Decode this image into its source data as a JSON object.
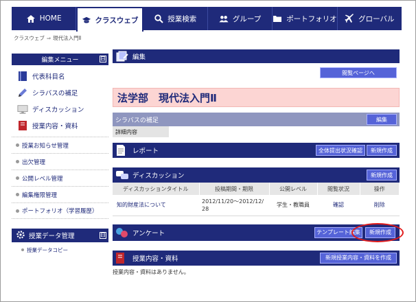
{
  "nav": {
    "tabs": [
      {
        "label": "HOME",
        "icon": "home-icon",
        "active": false
      },
      {
        "label": "クラスウェブ",
        "icon": "graduation-cap-icon",
        "active": true
      },
      {
        "label": "授業検索",
        "icon": "search-icon",
        "active": false
      },
      {
        "label": "グループ",
        "icon": "users-icon",
        "active": false
      },
      {
        "label": "ポートフォリオ",
        "icon": "folder-icon",
        "active": false
      },
      {
        "label": "グローバル",
        "icon": "plane-icon",
        "active": false
      }
    ]
  },
  "breadcrumb": {
    "root": "クラスウェブ",
    "sep": "⇒",
    "current": "現代法入門Ⅱ"
  },
  "sidebar": {
    "edit_menu_title": "編集メニュー",
    "minimize": "⊟",
    "icon_items": [
      {
        "label": "代表科目名",
        "icon": "book-icon"
      },
      {
        "label": "シラバスの補足",
        "icon": "pen-icon"
      },
      {
        "label": "ディスカッション",
        "icon": "monitor-icon"
      },
      {
        "label": "授業内容・資料",
        "icon": "notebook-icon"
      }
    ],
    "list_items": [
      "授業お知らせ管理",
      "出欠管理",
      "公開レベル管理",
      "編集権限管理",
      "ポートフォリオ（学習履歴）"
    ],
    "data_mgmt_title": "授業データ管理",
    "data_sub": "授業データコピー"
  },
  "main": {
    "edit_title": "編集",
    "view_page_button": "閲覧ページへ",
    "course_title": "法学部　現代法入門Ⅱ",
    "syllabus": {
      "title": "シラバスの補足",
      "edit_button": "編集",
      "detail_label": "詳細内容"
    },
    "report": {
      "title": "レポート",
      "status_button": "全体提出状況確認",
      "new_button": "新規作成"
    },
    "discussion": {
      "title": "ディスカッション",
      "new_button": "新規作成",
      "headers": [
        "ディスカッションタイトル",
        "投稿期間・期限",
        "公開レベル",
        "閲覧状況",
        "操作"
      ],
      "rows": [
        {
          "title": "知的財産法について",
          "period": "2012/11/20〜2012/12/28",
          "level": "学生・教職員",
          "status": "確認",
          "action": "削除"
        }
      ]
    },
    "survey": {
      "title": "アンケート",
      "template_button": "テンプレート編集",
      "new_button": "新規作成"
    },
    "materials": {
      "title": "授業内容・資料",
      "new_button": "新規授業内容・資料を作成",
      "empty": "授業内容・資料はありません。"
    }
  },
  "colors": {
    "navy": "#1f2a7a",
    "button": "#5563d8",
    "highlight_ring": "#e11b1b",
    "course_bg": "#fcd5d3"
  }
}
